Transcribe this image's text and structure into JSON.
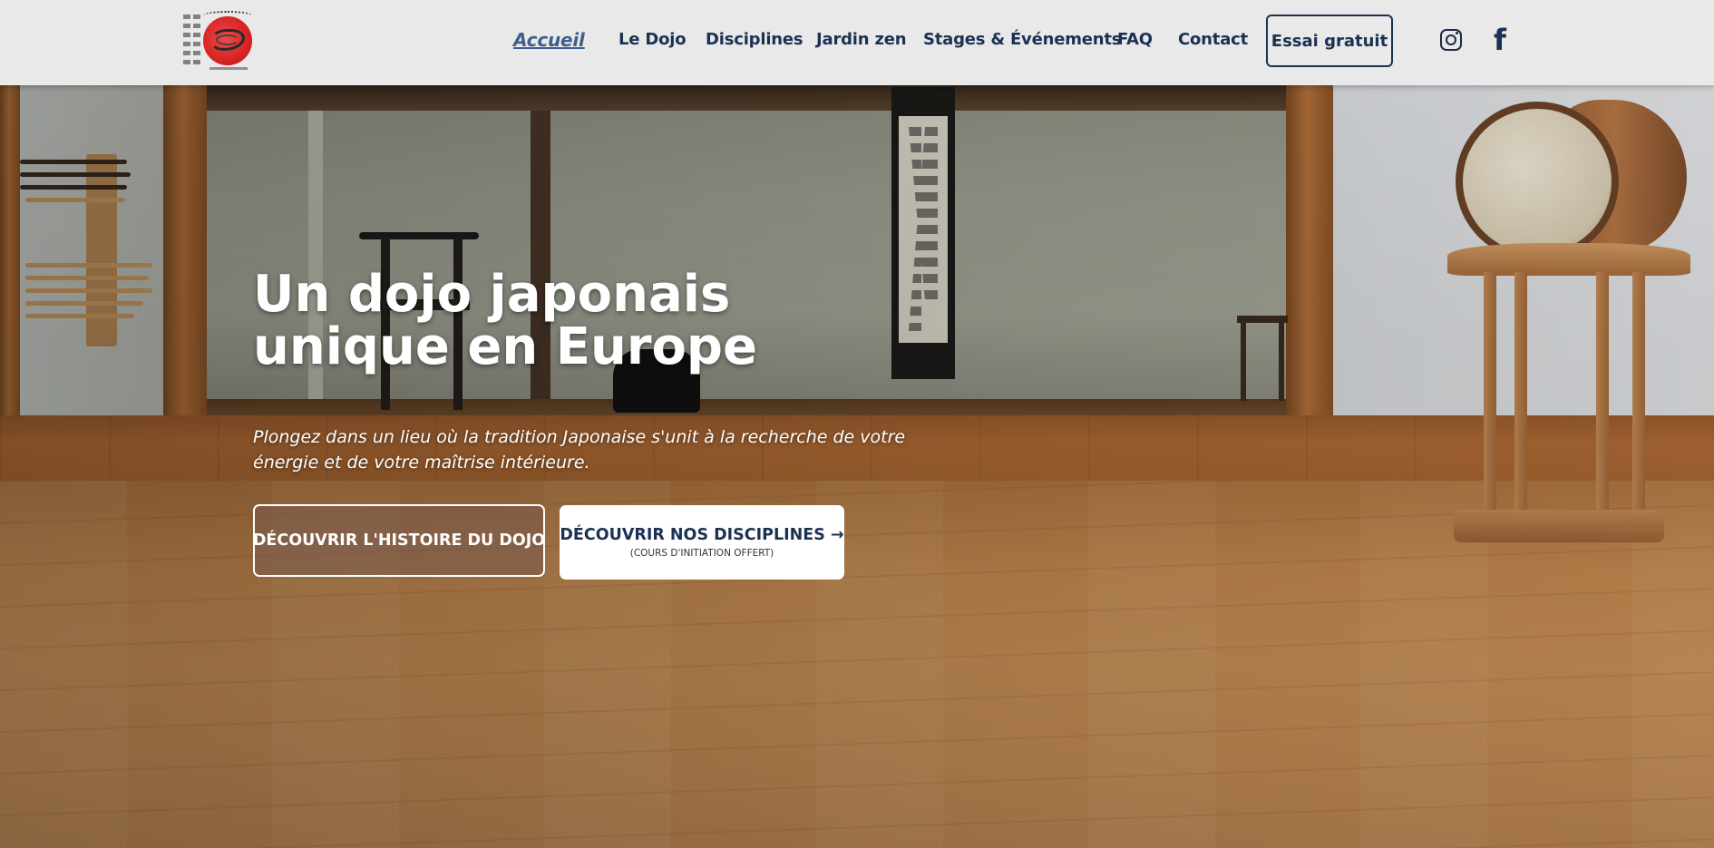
{
  "header": {
    "logo_alt": "Dojo Shodokan Vendée",
    "nav": [
      {
        "label": "Accueil",
        "active": true
      },
      {
        "label": "Le Dojo"
      },
      {
        "label": "Disciplines"
      },
      {
        "label": "Jardin zen"
      },
      {
        "label": "Stages & Événements"
      },
      {
        "label": "FAQ"
      },
      {
        "label": "Contact"
      }
    ],
    "cta_label": "Essai gratuit",
    "social": [
      {
        "icon": "instagram-icon"
      },
      {
        "icon": "facebook-icon",
        "glyph": "f"
      }
    ]
  },
  "hero": {
    "title": "Un dojo japonais unique en Europe",
    "subtitle": "Plongez dans un lieu où la tradition Japonaise s'unit à la recherche de votre énergie et de votre maîtrise intérieure.",
    "button_history": "DÉCOUVRIR L'HISTOIRE DU DOJO",
    "button_disciplines": "DÉCOUVRIR NOS DISCIPLINES →",
    "button_disciplines_note": "(COURS D'INITIATION OFFERT)"
  },
  "colors": {
    "navy": "#1b3154",
    "active_link": "#3e5f8e",
    "header_bg": "#e9e9e9",
    "logo_red": "#d21d1d"
  }
}
